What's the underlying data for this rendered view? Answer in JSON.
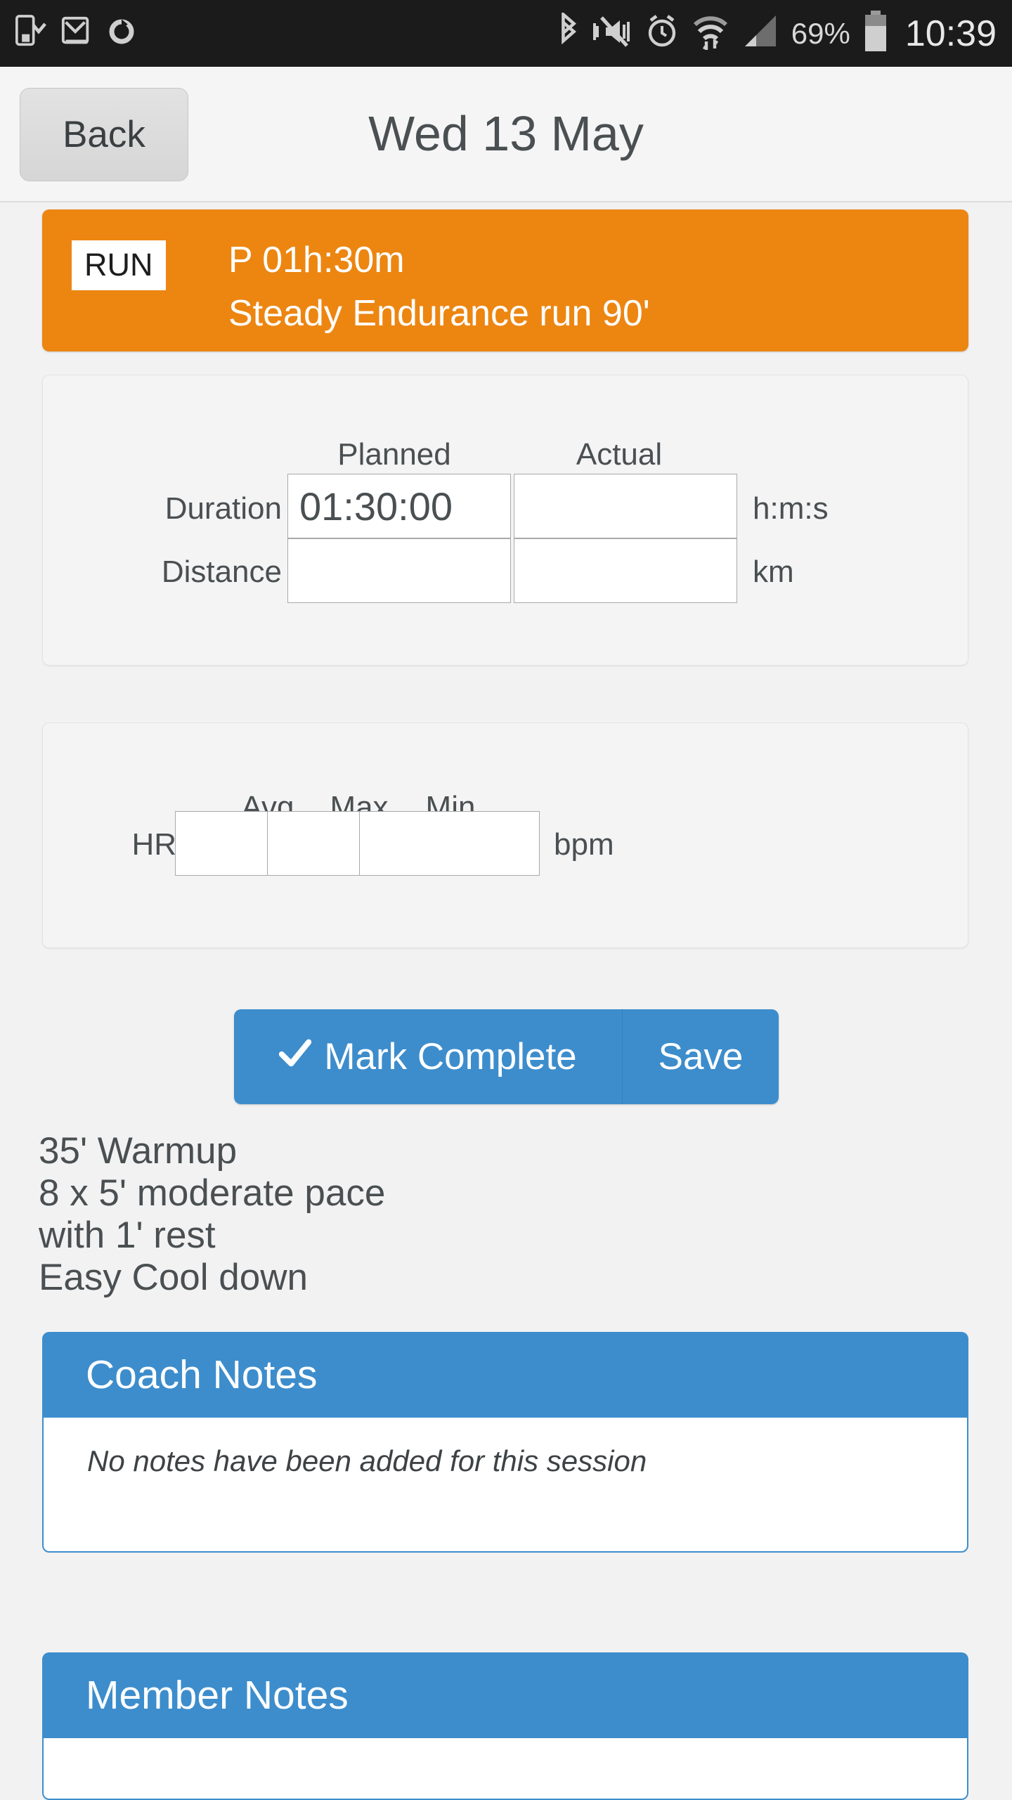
{
  "statusbar": {
    "left_icons": [
      "device-download-icon",
      "gmail-icon",
      "sync-icon"
    ],
    "right_icons": [
      "bluetooth-icon",
      "vibrate-mute-icon",
      "alarm-icon",
      "wifi-data-icon",
      "signal-icon"
    ],
    "battery_percent": "69%",
    "battery_icon": "battery-icon",
    "clock": "10:39"
  },
  "header": {
    "back_label": "Back",
    "title": "Wed 13 May"
  },
  "session": {
    "type_badge": "RUN",
    "planned_line": "P 01h:30m",
    "name_line": "Steady Endurance run 90'",
    "color": "#ec8611"
  },
  "metrics": {
    "col_headers": [
      "Planned",
      "Actual"
    ],
    "rows": [
      {
        "label": "Duration",
        "planned": "01:30:00",
        "actual": "",
        "unit": "h:m:s"
      },
      {
        "label": "Distance",
        "planned": "",
        "actual": "",
        "unit": "km"
      }
    ]
  },
  "heartrate": {
    "col_headers": [
      "Avg",
      "Max",
      "Min"
    ],
    "row_label": "HR",
    "values": [
      "",
      "",
      ""
    ],
    "unit": "bpm"
  },
  "actions": {
    "complete_label": "Mark Complete",
    "complete_icon": "check-icon",
    "save_label": "Save",
    "color": "#3d8dcc"
  },
  "description": {
    "lines": [
      "35' Warmup",
      "8 x 5' moderate pace",
      "with 1' rest",
      "Easy Cool down"
    ]
  },
  "coach_notes": {
    "title": "Coach Notes",
    "placeholder": "No notes have been added for this session"
  },
  "member_notes": {
    "title": "Member Notes",
    "placeholder": ""
  }
}
